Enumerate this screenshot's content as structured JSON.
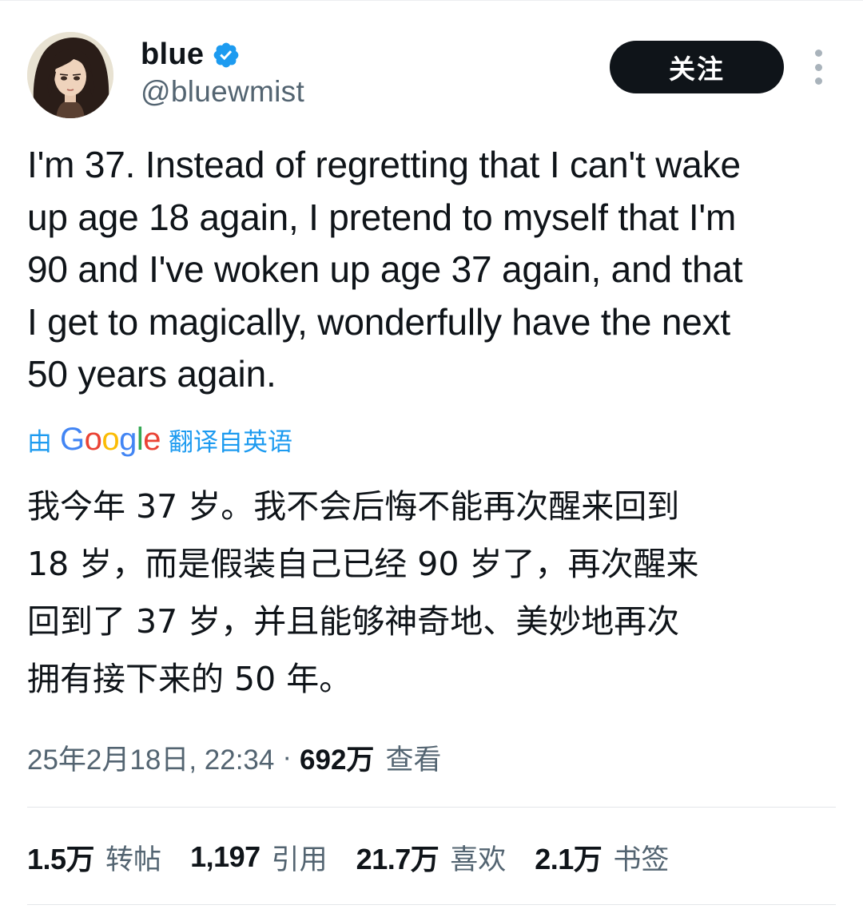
{
  "user": {
    "display_name": "blue",
    "handle": "@bluewmist",
    "verified": true,
    "verified_icon": "verified-badge-icon",
    "avatar_icon": "avatar-illustration"
  },
  "header": {
    "follow_label": "关注",
    "more_icon": "more-vertical-icon"
  },
  "tweet": {
    "lines": [
      "I'm 37. Instead of regretting that I can't wake",
      "up age 18 again, I pretend to myself that I'm",
      "90 and I've woken up age 37 again, and that",
      "I get to magically, wonderfully have the next",
      "50 years again."
    ]
  },
  "translation": {
    "prefix": "由",
    "provider_letters": [
      "G",
      "o",
      "o",
      "g",
      "l",
      "e"
    ],
    "suffix": "翻译自英语",
    "lines": [
      "我今年 37 岁。我不会后悔不能再次醒来回到",
      "18 岁，而是假装自己已经 90 岁了，再次醒来",
      "回到了 37 岁，并且能够神奇地、美妙地再次",
      "拥有接下来的 50 年。"
    ]
  },
  "meta": {
    "date": "25年2月18日, 22:34",
    "separator": "·",
    "views_count": "692万",
    "views_label": "查看"
  },
  "stats": [
    {
      "count": "1.5万",
      "label": "转帖"
    },
    {
      "count": "1,197",
      "label": "引用"
    },
    {
      "count": "21.7万",
      "label": "喜欢"
    },
    {
      "count": "2.1万",
      "label": "书签"
    }
  ],
  "colors": {
    "text_primary": "#0f1419",
    "text_secondary": "#536471",
    "link_blue": "#1d9bf0",
    "verified_blue": "#1d9bf0",
    "follow_bg": "#0f1419",
    "google_blue": "#4285f4",
    "google_red": "#ea4335",
    "google_yellow": "#fbbc05",
    "google_green": "#34a853"
  }
}
